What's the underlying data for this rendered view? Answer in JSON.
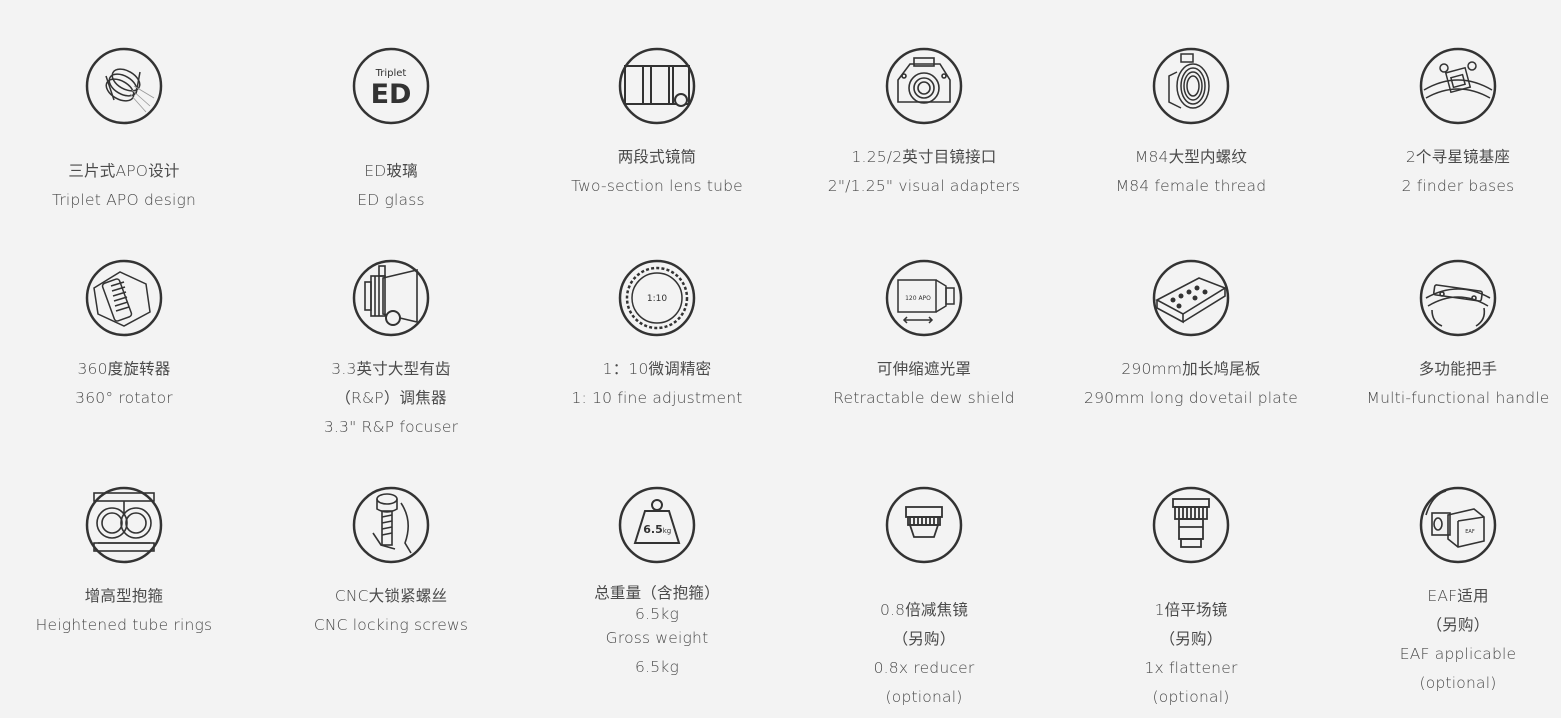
{
  "features": [
    {
      "icon": "triplet-lens-icon",
      "lines": [
        "三片式APO设计",
        "Triplet APO design"
      ]
    },
    {
      "icon": "ed-glass-icon",
      "icon_text": {
        "small": "Triplet",
        "big": "ED"
      },
      "lines": [
        "ED玻璃",
        "ED glass"
      ]
    },
    {
      "icon": "two-section-tube-icon",
      "lines": [
        "两段式镜筒",
        "Two-section lens tube"
      ]
    },
    {
      "icon": "visual-adapter-icon",
      "lines": [
        "1.25/2英寸目镜接口",
        "2\"/1.25\" visual adapters"
      ]
    },
    {
      "icon": "female-thread-icon",
      "lines": [
        "M84大型内螺纹",
        "M84 female thread"
      ]
    },
    {
      "icon": "finder-base-icon",
      "lines": [
        "2个寻星镜基座",
        "2 finder bases"
      ]
    },
    {
      "icon": "rotator-icon",
      "lines": [
        "360度旋转器",
        "360° rotator"
      ]
    },
    {
      "icon": "focuser-icon",
      "lines": [
        "3.3英寸大型有齿",
        "（R&P）调焦器",
        "3.3\" R&P focuser"
      ]
    },
    {
      "icon": "fine-adjustment-dial-icon",
      "icon_text": {
        "ratio": "1:10"
      },
      "lines": [
        "1：10微调精密",
        "1: 10 fine adjustment"
      ]
    },
    {
      "icon": "dew-shield-icon",
      "icon_text": {
        "label": "120 APO"
      },
      "lines": [
        "可伸缩遮光罩",
        "Retractable dew shield"
      ]
    },
    {
      "icon": "dovetail-plate-icon",
      "lines": [
        "290mm加长鸠尾板",
        "290mm long dovetail plate"
      ]
    },
    {
      "icon": "handle-icon",
      "lines": [
        "多功能把手",
        "Multi-functional handle"
      ]
    },
    {
      "icon": "tube-rings-icon",
      "lines": [
        "增高型抱箍",
        "Heightened tube rings"
      ]
    },
    {
      "icon": "locking-screw-icon",
      "lines": [
        "CNC大锁紧螺丝",
        "CNC locking screws"
      ]
    },
    {
      "icon": "weight-icon",
      "icon_text": {
        "weight": "6.5",
        "unit": "kg"
      },
      "lines": [
        "总重量（含抱箍）",
        "6.5kg",
        "Gross weight",
        "6.5kg"
      ]
    },
    {
      "icon": "reducer-icon",
      "lines": [
        "0.8倍减焦镜",
        "（另购）",
        "0.8x reducer",
        "(optional)"
      ]
    },
    {
      "icon": "flattener-icon",
      "lines": [
        "1倍平场镜",
        "（另购）",
        "1x flattener",
        "(optional)"
      ]
    },
    {
      "icon": "eaf-icon",
      "icon_text": {
        "label": "EAF"
      },
      "lines": [
        "EAF适用",
        "（另购）",
        "EAF applicable",
        "(optional)"
      ]
    }
  ]
}
